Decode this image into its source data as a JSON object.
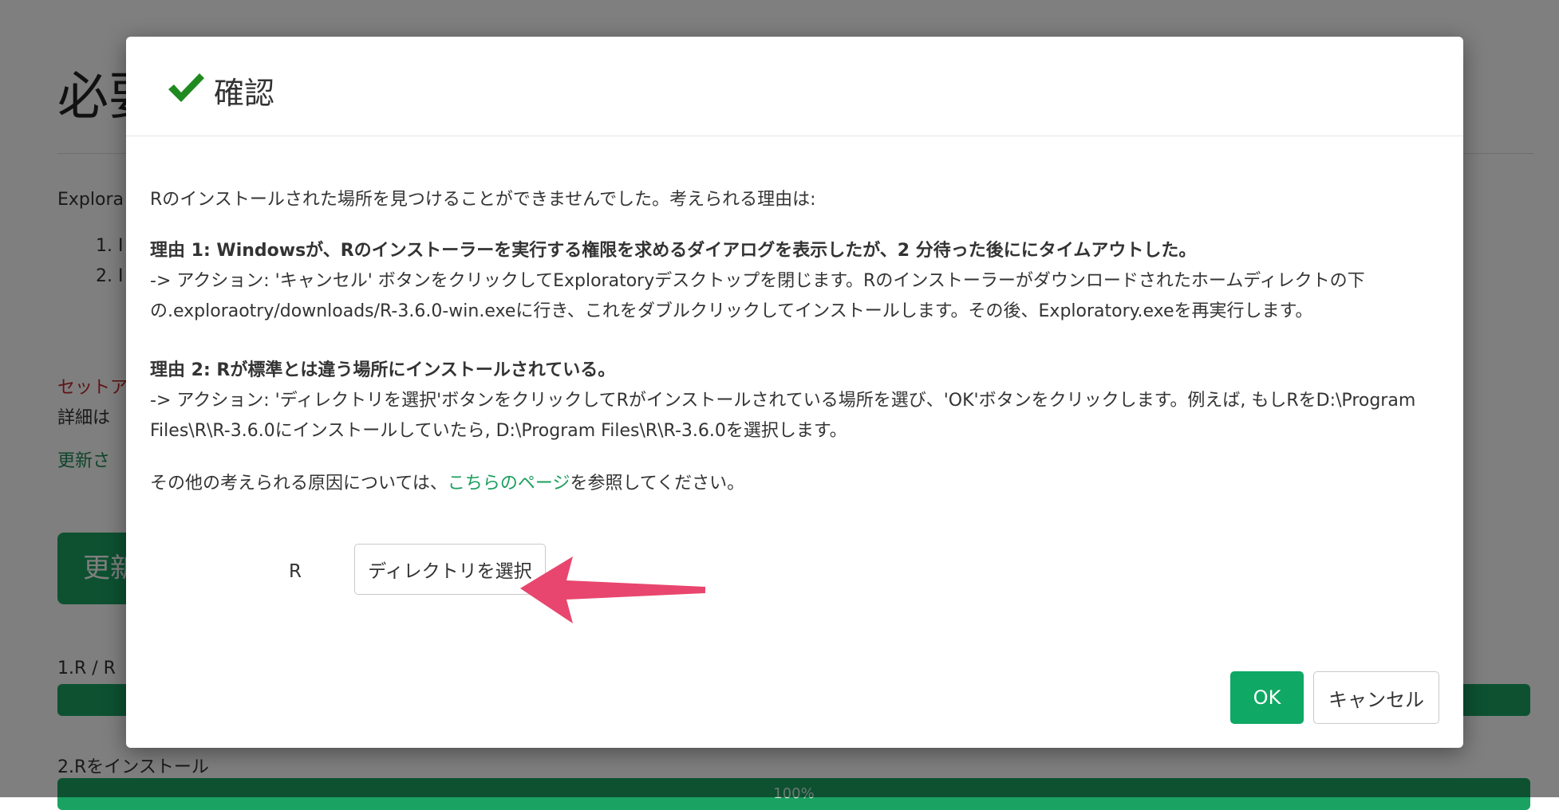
{
  "background": {
    "page_title": "必要",
    "intro_text": "Explora",
    "list_item_1": "1. I",
    "list_item_2": "2. I",
    "setup_text": "セットア",
    "detail_text": "詳細は",
    "updated_text": "更新さ",
    "update_button_label": "更新",
    "step1_label": "1.R / R",
    "step2_label": "2.Rをインストール",
    "step2_progress": "100%"
  },
  "dialog": {
    "icon": "check-icon",
    "title": "確認",
    "intro": "Rのインストールされた場所を見つけることができませんでした。考えられる理由は:",
    "reason1_title": "理由 1: Windowsが、Rのインストーラーを実行する権限を求めるダイアログを表示したが、2 分待った後ににタイムアウトした。",
    "reason1_action_line1": "-> アクション: 'キャンセル' ボタンをクリックしてExploratoryデスクトップを閉じます。Rのインストーラーがダウンロードされたホームディレクトの下",
    "reason1_action_line2": "の.exploraotry/downloads/R-3.6.0-win.exeに行き、これをダブルクリックしてインストールします。その後、Exploratory.exeを再実行します。",
    "reason2_title": "理由 2: Rが標準とは違う場所にインストールされている。",
    "reason2_action_line1": "-> アクション: 'ディレクトリを選択'ボタンをクリックしてRがインストールされている場所を選び、'OK'ボタンをクリックします。例えば, もしRをD:\\Program",
    "reason2_action_line2": "Files\\R\\R-3.6.0にインストールしていたら, D:\\Program Files\\R\\R-3.6.0を選択します。",
    "other_prefix": "その他の考えられる原因については、",
    "other_link": "こちらのページ",
    "other_suffix": "を参照してください。",
    "r_label": "R",
    "select_dir_button": "ディレクトリを選択",
    "ok_button": "OK",
    "cancel_button": "キャンセル"
  },
  "colors": {
    "accent_green": "#0fa864",
    "link_green": "#1a9e5d",
    "arrow_pink": "#e8466e",
    "check_green": "#1f8a1f"
  }
}
